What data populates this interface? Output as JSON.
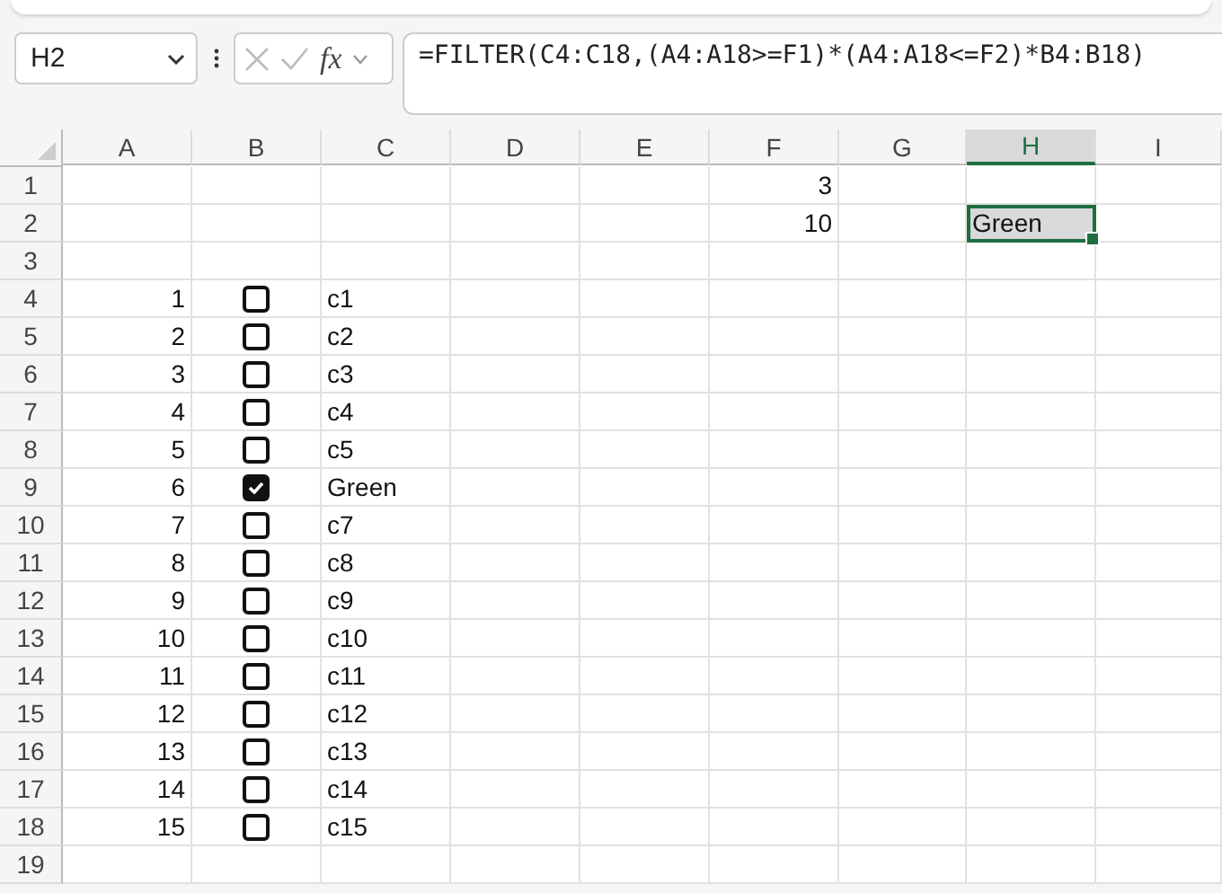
{
  "formula_bar": {
    "name_box": "H2",
    "function_label": "fx",
    "formula": "=FILTER(C4:C18,(A4:A18>=F1)*(A4:A18<=F2)*B4:B18)"
  },
  "columns": [
    {
      "label": "A",
      "selected": false
    },
    {
      "label": "B",
      "selected": false
    },
    {
      "label": "C",
      "selected": false
    },
    {
      "label": "D",
      "selected": false
    },
    {
      "label": "E",
      "selected": false
    },
    {
      "label": "F",
      "selected": false
    },
    {
      "label": "G",
      "selected": false
    },
    {
      "label": "H",
      "selected": true
    },
    {
      "label": "I",
      "selected": false
    }
  ],
  "rows": [
    {
      "label": "1",
      "f": {
        "kind": "number",
        "text": "3"
      }
    },
    {
      "label": "2",
      "f": {
        "kind": "number",
        "text": "10"
      },
      "h": {
        "kind": "text",
        "text": "Green",
        "selected": true
      }
    },
    {
      "label": "3"
    },
    {
      "label": "4",
      "a": {
        "kind": "number",
        "text": "1"
      },
      "b": {
        "kind": "checkbox",
        "checked": false
      },
      "c": {
        "kind": "text",
        "text": "c1"
      }
    },
    {
      "label": "5",
      "a": {
        "kind": "number",
        "text": "2"
      },
      "b": {
        "kind": "checkbox",
        "checked": false
      },
      "c": {
        "kind": "text",
        "text": "c2"
      }
    },
    {
      "label": "6",
      "a": {
        "kind": "number",
        "text": "3"
      },
      "b": {
        "kind": "checkbox",
        "checked": false
      },
      "c": {
        "kind": "text",
        "text": "c3"
      }
    },
    {
      "label": "7",
      "a": {
        "kind": "number",
        "text": "4"
      },
      "b": {
        "kind": "checkbox",
        "checked": false
      },
      "c": {
        "kind": "text",
        "text": "c4"
      }
    },
    {
      "label": "8",
      "a": {
        "kind": "number",
        "text": "5"
      },
      "b": {
        "kind": "checkbox",
        "checked": false
      },
      "c": {
        "kind": "text",
        "text": "c5"
      }
    },
    {
      "label": "9",
      "a": {
        "kind": "number",
        "text": "6"
      },
      "b": {
        "kind": "checkbox",
        "checked": true
      },
      "c": {
        "kind": "text",
        "text": "Green"
      }
    },
    {
      "label": "10",
      "a": {
        "kind": "number",
        "text": "7"
      },
      "b": {
        "kind": "checkbox",
        "checked": false
      },
      "c": {
        "kind": "text",
        "text": "c7"
      }
    },
    {
      "label": "11",
      "a": {
        "kind": "number",
        "text": "8"
      },
      "b": {
        "kind": "checkbox",
        "checked": false
      },
      "c": {
        "kind": "text",
        "text": "c8"
      }
    },
    {
      "label": "12",
      "a": {
        "kind": "number",
        "text": "9"
      },
      "b": {
        "kind": "checkbox",
        "checked": false
      },
      "c": {
        "kind": "text",
        "text": "c9"
      }
    },
    {
      "label": "13",
      "a": {
        "kind": "number",
        "text": "10"
      },
      "b": {
        "kind": "checkbox",
        "checked": false
      },
      "c": {
        "kind": "text",
        "text": "c10"
      }
    },
    {
      "label": "14",
      "a": {
        "kind": "number",
        "text": "11"
      },
      "b": {
        "kind": "checkbox",
        "checked": false
      },
      "c": {
        "kind": "text",
        "text": "c11"
      }
    },
    {
      "label": "15",
      "a": {
        "kind": "number",
        "text": "12"
      },
      "b": {
        "kind": "checkbox",
        "checked": false
      },
      "c": {
        "kind": "text",
        "text": "c12"
      }
    },
    {
      "label": "16",
      "a": {
        "kind": "number",
        "text": "13"
      },
      "b": {
        "kind": "checkbox",
        "checked": false
      },
      "c": {
        "kind": "text",
        "text": "c13"
      }
    },
    {
      "label": "17",
      "a": {
        "kind": "number",
        "text": "14"
      },
      "b": {
        "kind": "checkbox",
        "checked": false
      },
      "c": {
        "kind": "text",
        "text": "c14"
      }
    },
    {
      "label": "18",
      "a": {
        "kind": "number",
        "text": "15"
      },
      "b": {
        "kind": "checkbox",
        "checked": false
      },
      "c": {
        "kind": "text",
        "text": "c15"
      }
    },
    {
      "label": "19"
    }
  ]
}
